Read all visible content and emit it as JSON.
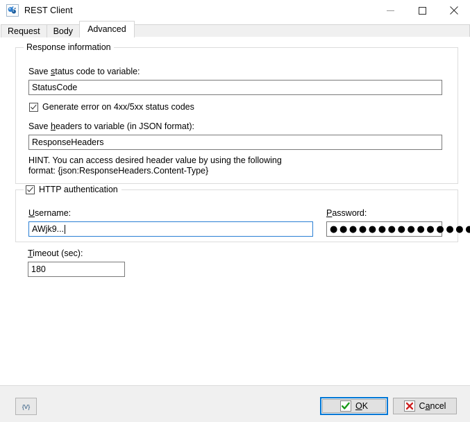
{
  "window": {
    "title": "REST Client",
    "app_icon": "rest-client-icon",
    "minimize_label": "Minimize",
    "maximize_label": "Maximize",
    "close_label": "Close"
  },
  "tabs": [
    {
      "label": "Request",
      "active": false
    },
    {
      "label": "Body",
      "active": false
    },
    {
      "label": "Advanced",
      "active": true
    }
  ],
  "response_group": {
    "caption": "Response information",
    "status_code_label_pre": "Save ",
    "status_code_label_acc": "s",
    "status_code_label_post": "tatus code to variable:",
    "status_code_value": "StatusCode",
    "generate_error_checkbox": {
      "label": "Generate error on 4xx/5xx  status codes",
      "checked": true
    },
    "headers_label_pre": "Save ",
    "headers_label_acc": "h",
    "headers_label_post": "eaders to variable (in JSON format):",
    "headers_value": "ResponseHeaders",
    "hint_line1": "HINT. You can access desired header value by using the following",
    "hint_line2": "format: {json:ResponseHeaders.Content-Type}"
  },
  "auth_group": {
    "caption": "HTTP authentication",
    "checked": true,
    "username_label_acc": "U",
    "username_label_post": "sername:",
    "username_value": "AWjk9...",
    "password_label_acc": "P",
    "password_label_post": "assword:",
    "password_masked": "●●●●●●●●●●●●●●●●●●●●●"
  },
  "timeout": {
    "label_acc": "T",
    "label_post": "imeout (sec):",
    "value": "180"
  },
  "footer": {
    "variables_button_label": "{V}",
    "ok_label_acc": "O",
    "ok_label_post": "K",
    "ok_icon": "green-check-icon",
    "cancel_label_pre": "C",
    "cancel_label_acc": "a",
    "cancel_label_post": "ncel",
    "cancel_icon": "red-x-icon"
  },
  "colors": {
    "focus_blue": "#0078d7",
    "ok_check_green": "#1a9a1a",
    "cancel_x_red": "#cc2020",
    "footer_bg": "#f0f0f0",
    "group_border": "#dcdcdc"
  }
}
